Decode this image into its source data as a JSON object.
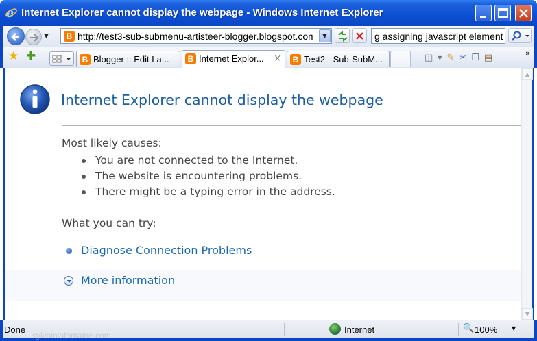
{
  "window": {
    "title": "Internet Explorer cannot display the webpage - Windows Internet Explorer"
  },
  "address_bar": {
    "url": "http://test3-sub-submenu-artisteer-blogger.blogspot.com/"
  },
  "search_box": {
    "value": "g assigning javascript element"
  },
  "tabs": [
    {
      "label": "Blogger :: Edit La...",
      "active": false
    },
    {
      "label": "Internet Explor...",
      "active": true,
      "close": "×"
    },
    {
      "label": "Test2 - Sub-SubM...",
      "active": false
    }
  ],
  "page": {
    "title": "Internet Explorer cannot display the webpage",
    "causes_heading": "Most likely causes:",
    "causes": [
      "You are not connected to the Internet.",
      "The website is encountering problems.",
      "There might be a typing error in the address."
    ],
    "try_heading": "What you can try:",
    "diagnose_link": "Diagnose Connection Problems",
    "more_info_link": "More information"
  },
  "status_bar": {
    "status": "Done",
    "watermark": "sylvainlafontaine.com",
    "zone": "Internet",
    "zoom": "100%"
  },
  "icons": {
    "page_icon": "info-icon",
    "tab_icon": "blogger-icon"
  },
  "colors": {
    "titlebar": "#0b47c4",
    "link": "#1a69b3",
    "page_title": "#1f5fa0",
    "blogger": "#f57d00"
  }
}
